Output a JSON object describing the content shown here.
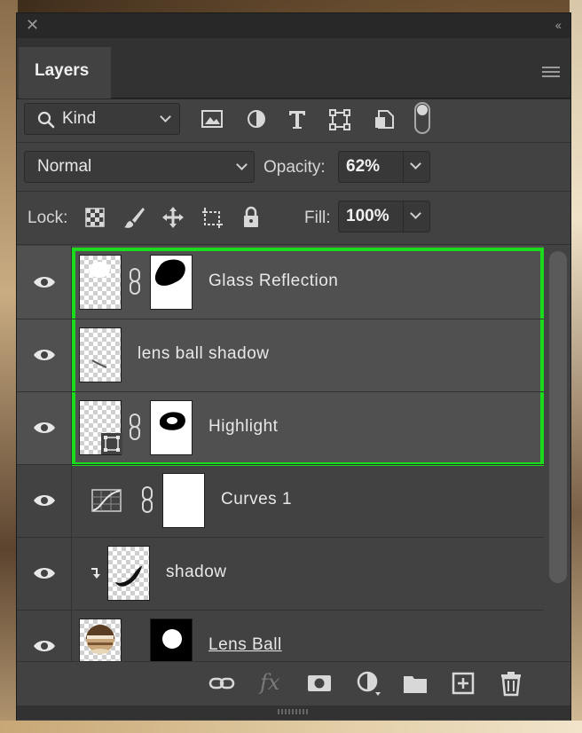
{
  "window": {
    "close_glyph": "✕",
    "collapse_glyph": "‹‹",
    "tab_label": "Layers"
  },
  "filter": {
    "kind_label": "Kind",
    "icons": [
      "image-filter-icon",
      "adjustment-filter-icon",
      "type-filter-icon",
      "shape-filter-icon",
      "smart-object-filter-icon"
    ]
  },
  "blend": {
    "mode": "Normal",
    "opacity_label": "Opacity:",
    "opacity_value": "62%"
  },
  "lock": {
    "label": "Lock:",
    "fill_label": "Fill:",
    "fill_value": "100%",
    "icons": [
      "lock-transparent-pixels-icon",
      "lock-image-pixels-icon",
      "lock-position-icon",
      "lock-artboard-icon",
      "lock-all-icon"
    ]
  },
  "layers": [
    {
      "name": "Glass Reflection",
      "selected": true,
      "has_mask": true
    },
    {
      "name": "lens ball shadow",
      "selected": true,
      "has_mask": false
    },
    {
      "name": "Highlight",
      "selected": true,
      "has_mask": true,
      "smart_object": true
    },
    {
      "name": "Curves 1",
      "selected": false,
      "has_mask": true,
      "adjustment": "curves"
    },
    {
      "name": "shadow",
      "selected": false,
      "has_mask": false,
      "clipped": true
    },
    {
      "name": "Lens Ball",
      "selected": false,
      "has_mask": true
    }
  ],
  "bottom_toolbar": {
    "fx_label": "fx",
    "icons": [
      "link-layers-icon",
      "fx-icon",
      "add-mask-icon",
      "adjustment-layer-icon",
      "new-group-icon",
      "new-layer-icon",
      "delete-layer-icon"
    ]
  },
  "colors": {
    "selection_outline": "#1bdc1b",
    "panel_bg": "#424242",
    "selected_row": "#505050"
  }
}
